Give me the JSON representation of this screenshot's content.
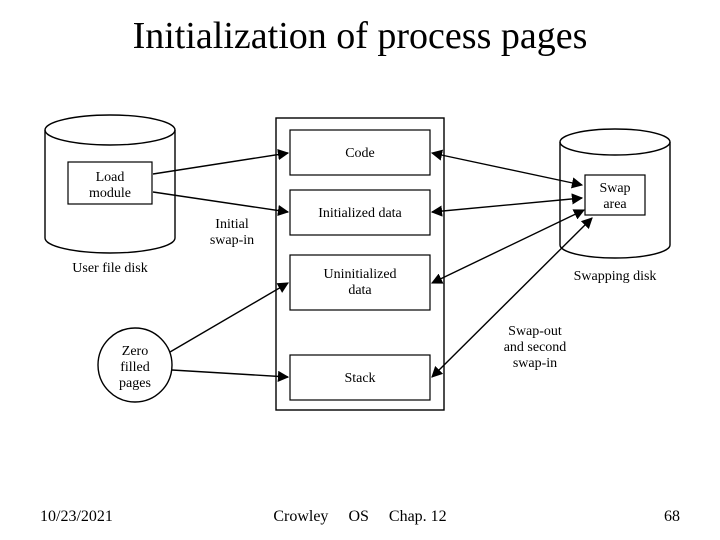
{
  "title": "Initialization of process pages",
  "footer": {
    "date": "10/23/2021",
    "author": "Crowley",
    "course": "OS",
    "chapter": "Chap. 12",
    "page": "68"
  },
  "diagram": {
    "left_cyl": "Load module",
    "left_cyl_caption": "User file disk",
    "circle": {
      "l1": "Zero",
      "l2": "filled",
      "l3": "pages"
    },
    "center_segments": [
      "Code",
      "Initialized data",
      "Uninitialized data",
      "Stack"
    ],
    "uninit": {
      "l1": "Uninitialized",
      "l2": "data"
    },
    "label_initial": {
      "l1": "Initial",
      "l2": "swap-in"
    },
    "label_swapout": {
      "l1": "Swap-out",
      "l2": "and second",
      "l3": "swap-in"
    },
    "right_cyl": {
      "l1": "Swap",
      "l2": "area"
    },
    "right_cyl_caption": "Swapping disk"
  }
}
